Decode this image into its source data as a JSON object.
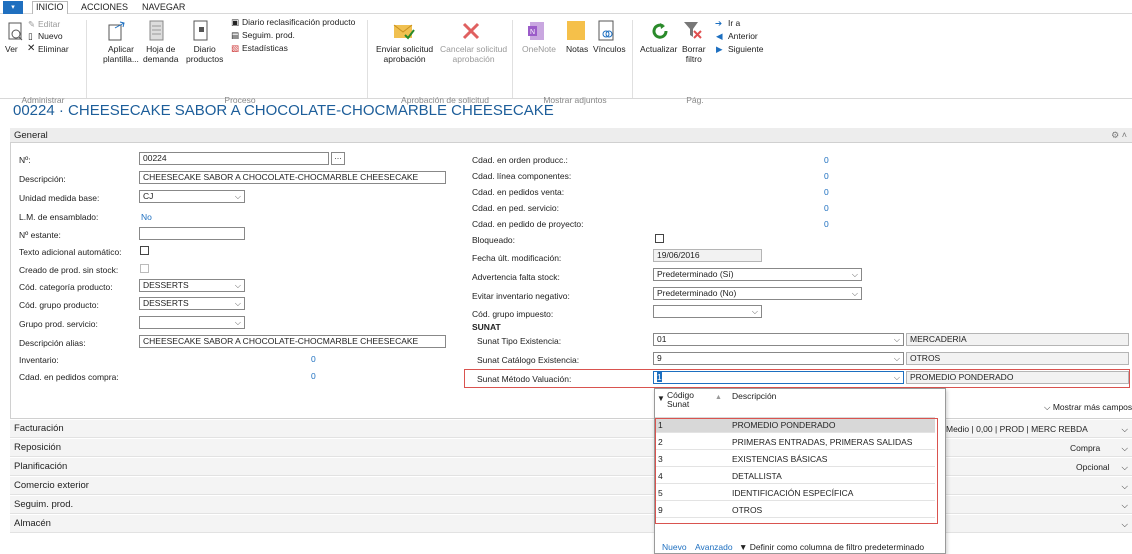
{
  "tabs": {
    "menu": "▾",
    "inicio": "INICIO",
    "acciones": "ACCIONES",
    "navegar": "NAVEGAR"
  },
  "ribbon": {
    "editar": "Editar",
    "nuevo": "Nuevo",
    "eliminar": "Eliminar",
    "ver": "Ver",
    "aplicar": "Aplicar",
    "plantilla": "plantilla...",
    "hoja": "Hoja de",
    "demanda": "demanda",
    "diario": "Diario",
    "productos": "productos",
    "diario_reclas": "Diario reclasificación producto",
    "seguim": "Seguim. prod.",
    "estadisticas": "Estadísticas",
    "enviar": "Enviar solicitud",
    "aprobacion": "aprobación",
    "cancelar": "Cancelar solicitud",
    "aprobacion2": "aprobación",
    "onenote": "OneNote",
    "notas": "Notas",
    "vinculos": "Vínculos",
    "actualizar": "Actualizar",
    "borrar": "Borrar",
    "filtro": "filtro",
    "ira": "Ir a",
    "anterior": "Anterior",
    "siguiente": "Siguiente",
    "grp_admin": "Administrar",
    "grp_proceso": "Proceso",
    "grp_aprob": "Aprobación de solicitud",
    "grp_adjuntos": "Mostrar adjuntos",
    "grp_pag": "Pág."
  },
  "page_title": "00224 · CHEESECAKE SABOR A CHOCOLATE-CHOCMARBLE CHEESECAKE",
  "general": {
    "header": "General",
    "no_label": "Nº:",
    "no_value": "00224",
    "desc_label": "Descripción:",
    "desc_value": "CHEESECAKE SABOR A CHOCOLATE-CHOCMARBLE CHEESECAKE",
    "unidad_label": "Unidad medida base:",
    "unidad_value": "CJ",
    "lm_label": "L.M. de ensamblado:",
    "lm_value": "No",
    "estante_label": "Nº estante:",
    "texto_label": "Texto adicional automático:",
    "creado_label": "Creado de prod. sin stock:",
    "cat_label": "Cód. categoría producto:",
    "cat_value": "DESSERTS",
    "grupo_label": "Cód. grupo producto:",
    "grupo_value": "DESSERTS",
    "grupo_serv_label": "Grupo prod. servicio:",
    "alias_label": "Descripción alias:",
    "alias_value": "CHEESECAKE SABOR A CHOCOLATE-CHOCMARBLE CHEESECAKE",
    "inventario_label": "Inventario:",
    "inventario_value": "0",
    "pedidos_compra_label": "Cdad. en pedidos compra:",
    "pedidos_compra_value": "0",
    "orden_label": "Cdad. en orden producc.:",
    "orden_value": "0",
    "linea_label": "Cdad. línea componentes:",
    "linea_value": "0",
    "venta_label": "Cdad. en pedidos venta:",
    "venta_value": "0",
    "servicio_label": "Cdad. en ped. servicio:",
    "servicio_value": "0",
    "proyecto_label": "Cdad. en pedido de proyecto:",
    "proyecto_value": "0",
    "bloqueado_label": "Bloqueado:",
    "fecha_label": "Fecha últ. modificación:",
    "fecha_value": "19/06/2016",
    "advertencia_label": "Advertencia falta stock:",
    "advertencia_value": "Predeterminado (Sí)",
    "evitar_label": "Evitar inventario negativo:",
    "evitar_value": "Predeterminado (No)",
    "impuesto_label": "Cód. grupo impuesto:",
    "sunat_heading": "SUNAT",
    "tipo_label": "Sunat Tipo Existencia:",
    "tipo_value": "01",
    "tipo_desc": "MERCADERIA",
    "catalogo_label": "Sunat Catálogo Existencia:",
    "catalogo_value": "9",
    "catalogo_desc": "OTROS",
    "metodo_label": "Sunat Método Valuación:",
    "metodo_value": "1",
    "metodo_desc": "PROMEDIO PONDERADO",
    "mostrar_mas": "Mostrar más campos"
  },
  "fasttabs": {
    "facturacion": "Facturación",
    "reposicion": "Reposición",
    "planificacion": "Planificación",
    "comercio": "Comercio exterior",
    "seguim": "Seguim. prod.",
    "almacen": "Almacén",
    "fact_medio": "Medio",
    "fact_val": "0,00",
    "fact_prod": "PROD",
    "fact_merc": "MERC REBDA",
    "repo_val": "Compra",
    "plan_val": "Opcional"
  },
  "dropdown": {
    "col_codigo": "Código",
    "col_sunat": "Sunat",
    "col_desc": "Descripción",
    "rows": [
      {
        "code": "1",
        "desc": "PROMEDIO PONDERADO"
      },
      {
        "code": "2",
        "desc": "PRIMERAS ENTRADAS, PRIMERAS SALIDAS"
      },
      {
        "code": "3",
        "desc": "EXISTENCIAS BÁSICAS"
      },
      {
        "code": "4",
        "desc": "DETALLISTA"
      },
      {
        "code": "5",
        "desc": "IDENTIFICACIÓN ESPECÍFICA"
      },
      {
        "code": "9",
        "desc": "OTROS"
      }
    ],
    "nuevo": "Nuevo",
    "avanzado": "Avanzado",
    "definir": "Definir como columna de filtro predeterminado"
  },
  "colors": {
    "accent": "#1d6fc0",
    "title": "#1d5e9a",
    "highlight": "#d9534f",
    "selected_row": "#d8d8d8"
  }
}
